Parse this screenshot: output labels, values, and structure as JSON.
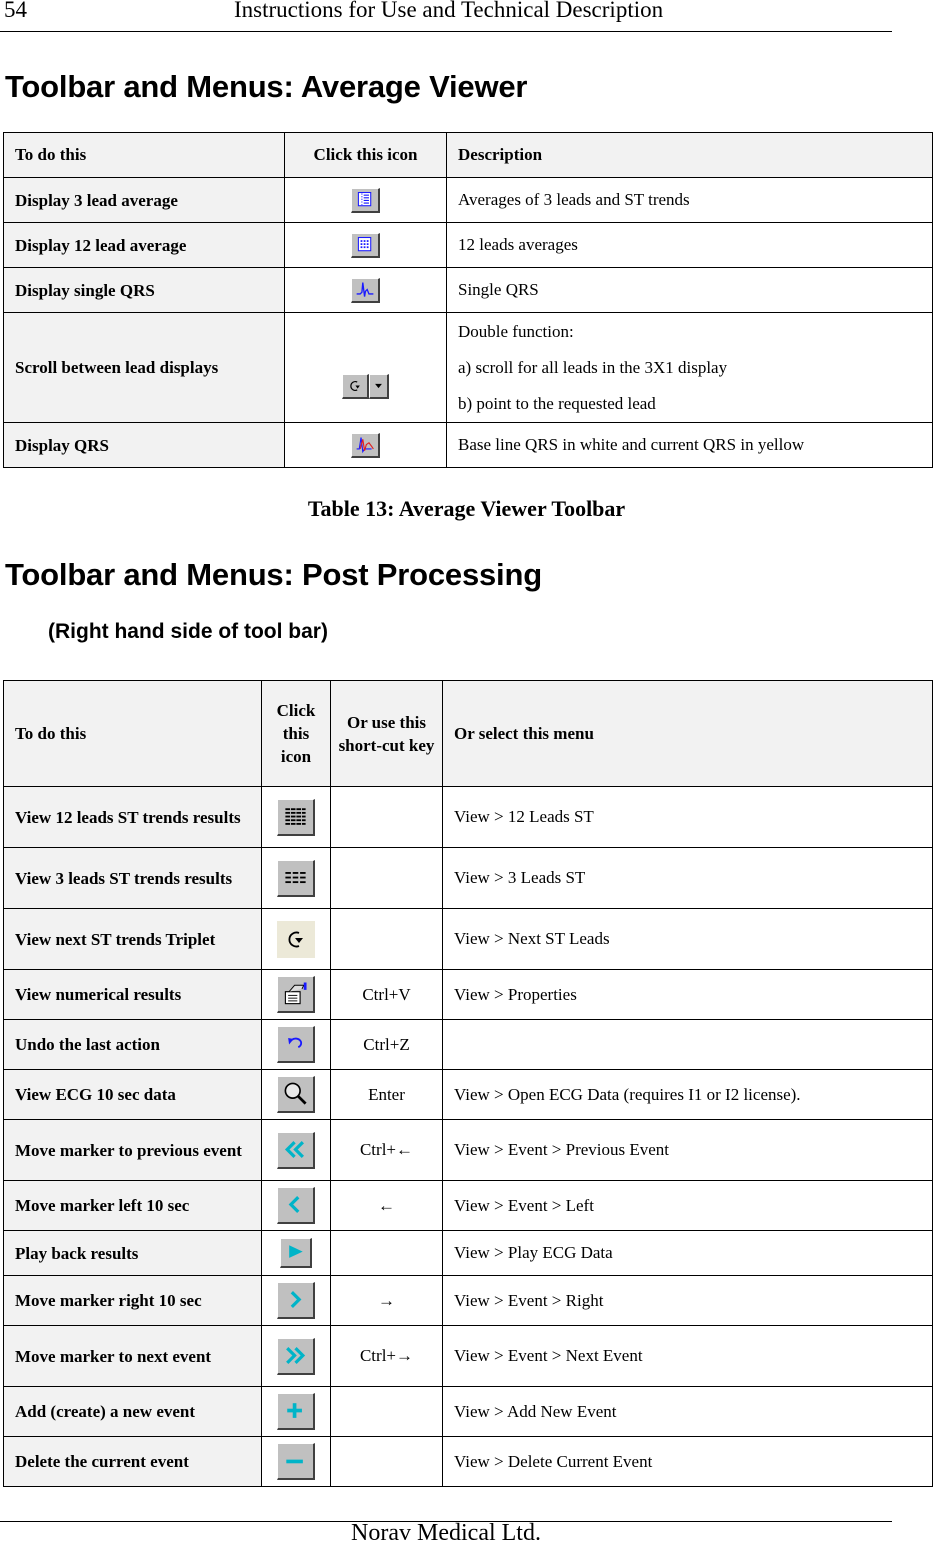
{
  "header": {
    "page_number": "54",
    "running_title": "Instructions for Use and Technical Description"
  },
  "section_average": {
    "title": "Toolbar and Menus: Average Viewer",
    "table": {
      "columns": [
        "To do this",
        "Click this icon",
        "Description"
      ],
      "rows": [
        {
          "action": "Display 3 lead average",
          "icon": "three-lead-average-icon",
          "description": [
            "Averages of 3 leads and ST trends"
          ]
        },
        {
          "action": "Display 12 lead average",
          "icon": "twelve-lead-average-icon",
          "description": [
            "12 leads averages"
          ]
        },
        {
          "action": "Display single QRS",
          "icon": "single-qrs-icon",
          "description": [
            "Single QRS"
          ]
        },
        {
          "action": "Scroll between lead displays",
          "icon": "scroll-leads-dropdown-icon",
          "description": [
            "Double function:",
            "a) scroll for all leads in the 3X1 display",
            "b) point to the requested lead"
          ]
        },
        {
          "action": "Display QRS",
          "icon": "display-qrs-icon",
          "description": [
            "Base line QRS in white and current QRS in yellow"
          ]
        }
      ]
    },
    "caption": "Table 13: Average Viewer Toolbar"
  },
  "section_post": {
    "title": "Toolbar and Menus: Post Processing",
    "subtitle": "(Right hand side of tool bar)",
    "table": {
      "columns": [
        "To do this",
        "Click this icon",
        "Or use this short-cut key",
        "Or select this menu"
      ],
      "rows": [
        {
          "action": "View 12 leads ST trends results",
          "icon": "twelve-leads-st-grid-icon",
          "shortcut": "",
          "menu": "View > 12 Leads ST"
        },
        {
          "action": "View 3 leads ST trends results",
          "icon": "three-leads-st-grid-icon",
          "shortcut": "",
          "menu": "View > 3 Leads ST"
        },
        {
          "action": "View next ST trends Triplet",
          "icon": "next-triplet-rotate-icon",
          "shortcut": "",
          "menu": "View > Next ST Leads"
        },
        {
          "action": "View numerical results",
          "icon": "properties-icon",
          "shortcut": "Ctrl+V",
          "menu": "View > Properties"
        },
        {
          "action": "Undo the last action",
          "icon": "undo-icon",
          "shortcut": "Ctrl+Z",
          "menu": ""
        },
        {
          "action": "View ECG 10 sec data",
          "icon": "magnifier-icon",
          "shortcut": "Enter",
          "menu": "View > Open ECG Data (requires I1 or I2 license)."
        },
        {
          "action": "Move marker to previous event",
          "icon": "double-chevron-left-icon",
          "shortcut": "Ctrl+←",
          "menu": "View > Event > Previous Event"
        },
        {
          "action": "Move marker left 10 sec",
          "icon": "chevron-left-icon",
          "shortcut": "←",
          "menu": "View > Event > Left"
        },
        {
          "action": "Play back results",
          "icon": "play-icon",
          "shortcut": "",
          "menu": "View > Play ECG Data"
        },
        {
          "action": "Move marker  right 10 sec",
          "icon": "chevron-right-icon",
          "shortcut": "→",
          "menu": "View > Event > Right"
        },
        {
          "action": "Move marker to next event",
          "icon": "double-chevron-right-icon",
          "shortcut": "Ctrl+→",
          "menu": "View > Event > Next Event"
        },
        {
          "action": "Add (create) a new event",
          "icon": "plus-icon",
          "shortcut": "",
          "menu": "View > Add New Event"
        },
        {
          "action": "Delete the current event",
          "icon": "minus-icon",
          "shortcut": "",
          "menu": "View > Delete Current Event"
        }
      ]
    }
  },
  "footer": {
    "company": "Norav Medical Ltd."
  },
  "colors": {
    "button_face": "#c0c0c0",
    "header_cell_bg": "#f2f2f2",
    "icon_blue": "#1a1aff",
    "icon_teal": "#00b4c8",
    "icon_red": "#e02020"
  }
}
